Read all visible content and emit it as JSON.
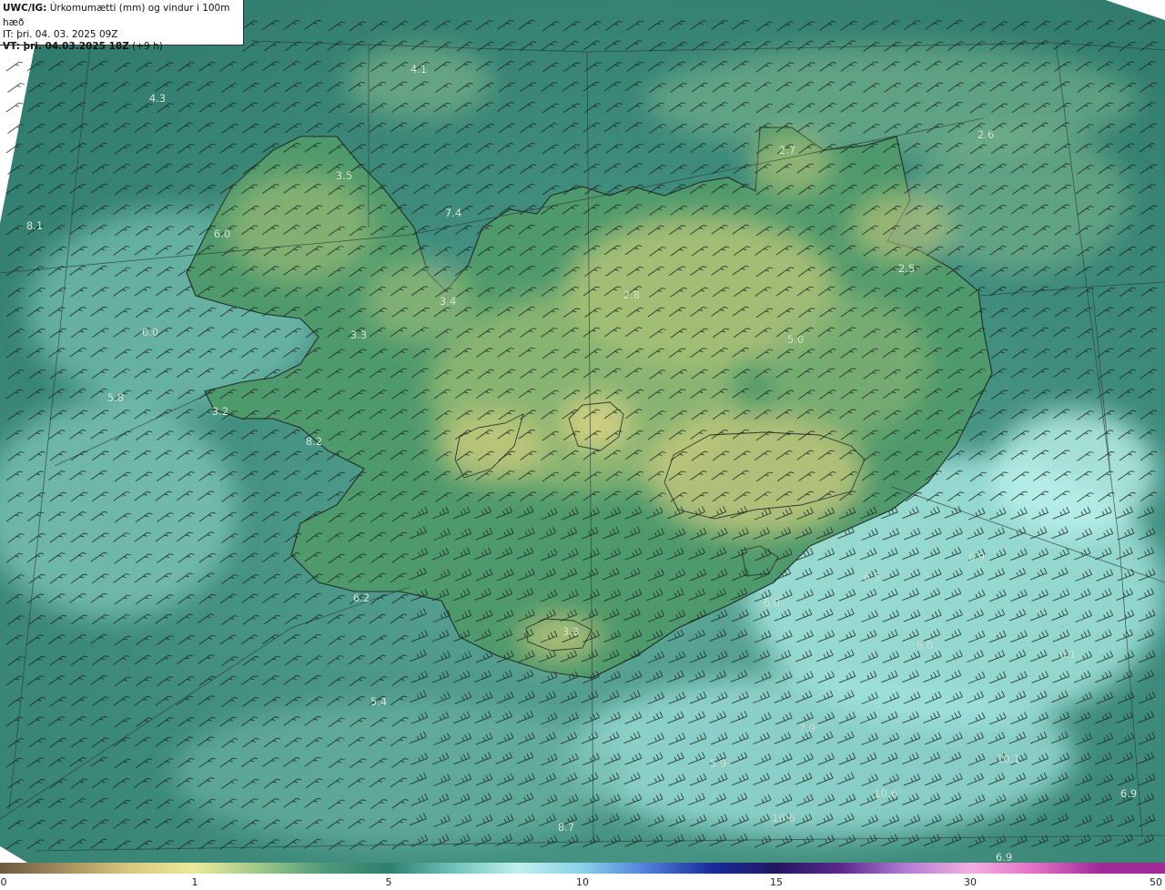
{
  "header": {
    "model": "UWC/IG:",
    "title": "Úrkomumætti (mm) og vindur i 100m hæð",
    "it_line": "IT: þri. 04. 03. 2025 09Z",
    "vt_bold": "VT: þri. 04.03.2025 18Z",
    "vt_offset": "(+9 h)"
  },
  "colorbar": {
    "ticks": [
      "0",
      "1",
      "5",
      "10",
      "15",
      "30",
      "50"
    ],
    "colors": [
      "#6b5a42",
      "#a58d5e",
      "#d7c980",
      "#eaea9a",
      "#9fc88a",
      "#4f9a7a",
      "#2f7f6f",
      "#6fc2b8",
      "#bff0ec",
      "#8ad0ea",
      "#4e7fd8",
      "#1a2d9a",
      "#221660",
      "#5b2a8c",
      "#b27dd3",
      "#f3b0df",
      "#e36ec4",
      "#a12a98"
    ]
  },
  "map": {
    "point_values": [
      "4.1",
      "4.3",
      "3.5",
      "8.1",
      "6.0",
      "7.4",
      "2.7",
      "2.6",
      "3.4",
      "2.8",
      "2.5",
      "6.0",
      "3.3",
      "5.0",
      "5.8",
      "3.2",
      "8.2",
      "6.9",
      "6.5",
      "6.2",
      "6.0",
      "3.3",
      "6.0",
      "6.1",
      "5.4",
      "7.9",
      "5.9",
      "10.1",
      "10.6",
      "6.9",
      "10.6",
      "8.7",
      "6.9"
    ]
  }
}
